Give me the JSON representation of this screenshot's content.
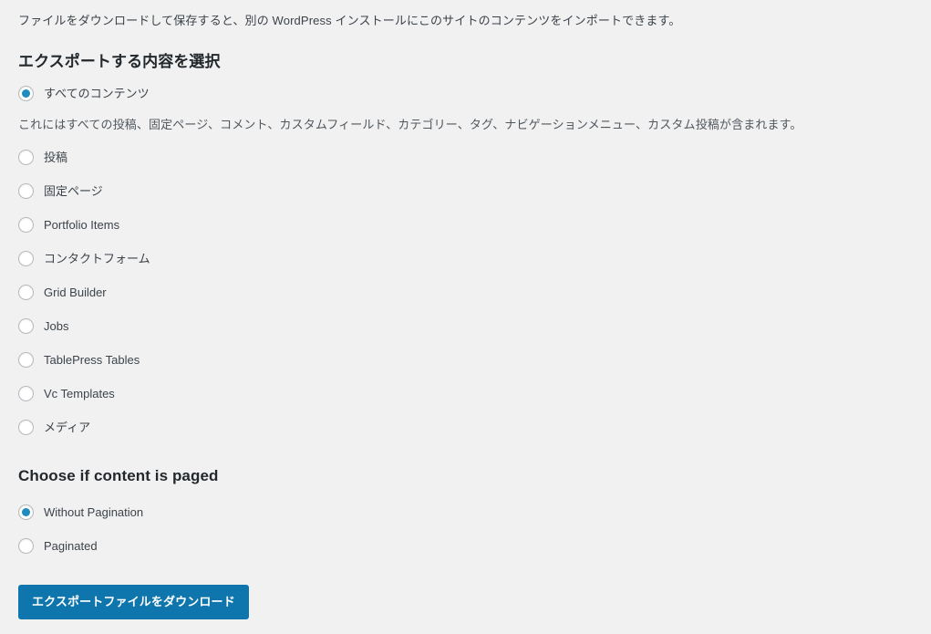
{
  "intro": {
    "text": "ファイルをダウンロードして保存すると、別の WordPress インストールにこのサイトのコンテンツをインポートできます。"
  },
  "export_section": {
    "heading": "エクスポートする内容を選択",
    "all_content": {
      "label": "すべてのコンテンツ",
      "selected": true,
      "description": "これにはすべての投稿、固定ページ、コメント、カスタムフィールド、カテゴリー、タグ、ナビゲーションメニュー、カスタム投稿が含まれます。"
    },
    "options": [
      {
        "label": "投稿",
        "selected": false
      },
      {
        "label": "固定ページ",
        "selected": false
      },
      {
        "label": "Portfolio Items",
        "selected": false
      },
      {
        "label": "コンタクトフォーム",
        "selected": false
      },
      {
        "label": "Grid Builder",
        "selected": false
      },
      {
        "label": "Jobs",
        "selected": false
      },
      {
        "label": "TablePress Tables",
        "selected": false
      },
      {
        "label": "Vc Templates",
        "selected": false
      },
      {
        "label": "メディア",
        "selected": false
      }
    ]
  },
  "pagination_section": {
    "heading": "Choose if content is paged",
    "options": [
      {
        "label": "Without Pagination",
        "selected": true
      },
      {
        "label": "Paginated",
        "selected": false
      }
    ]
  },
  "submit": {
    "label": "エクスポートファイルをダウンロード"
  },
  "colors": {
    "page_background": "#f1f1f1",
    "radio_accent": "#1e8cbe",
    "button_background": "#0e76ad",
    "heading_text": "#23282d",
    "body_text": "#3c434a",
    "muted_text": "#50575e",
    "radio_border": "#b4b9be"
  }
}
